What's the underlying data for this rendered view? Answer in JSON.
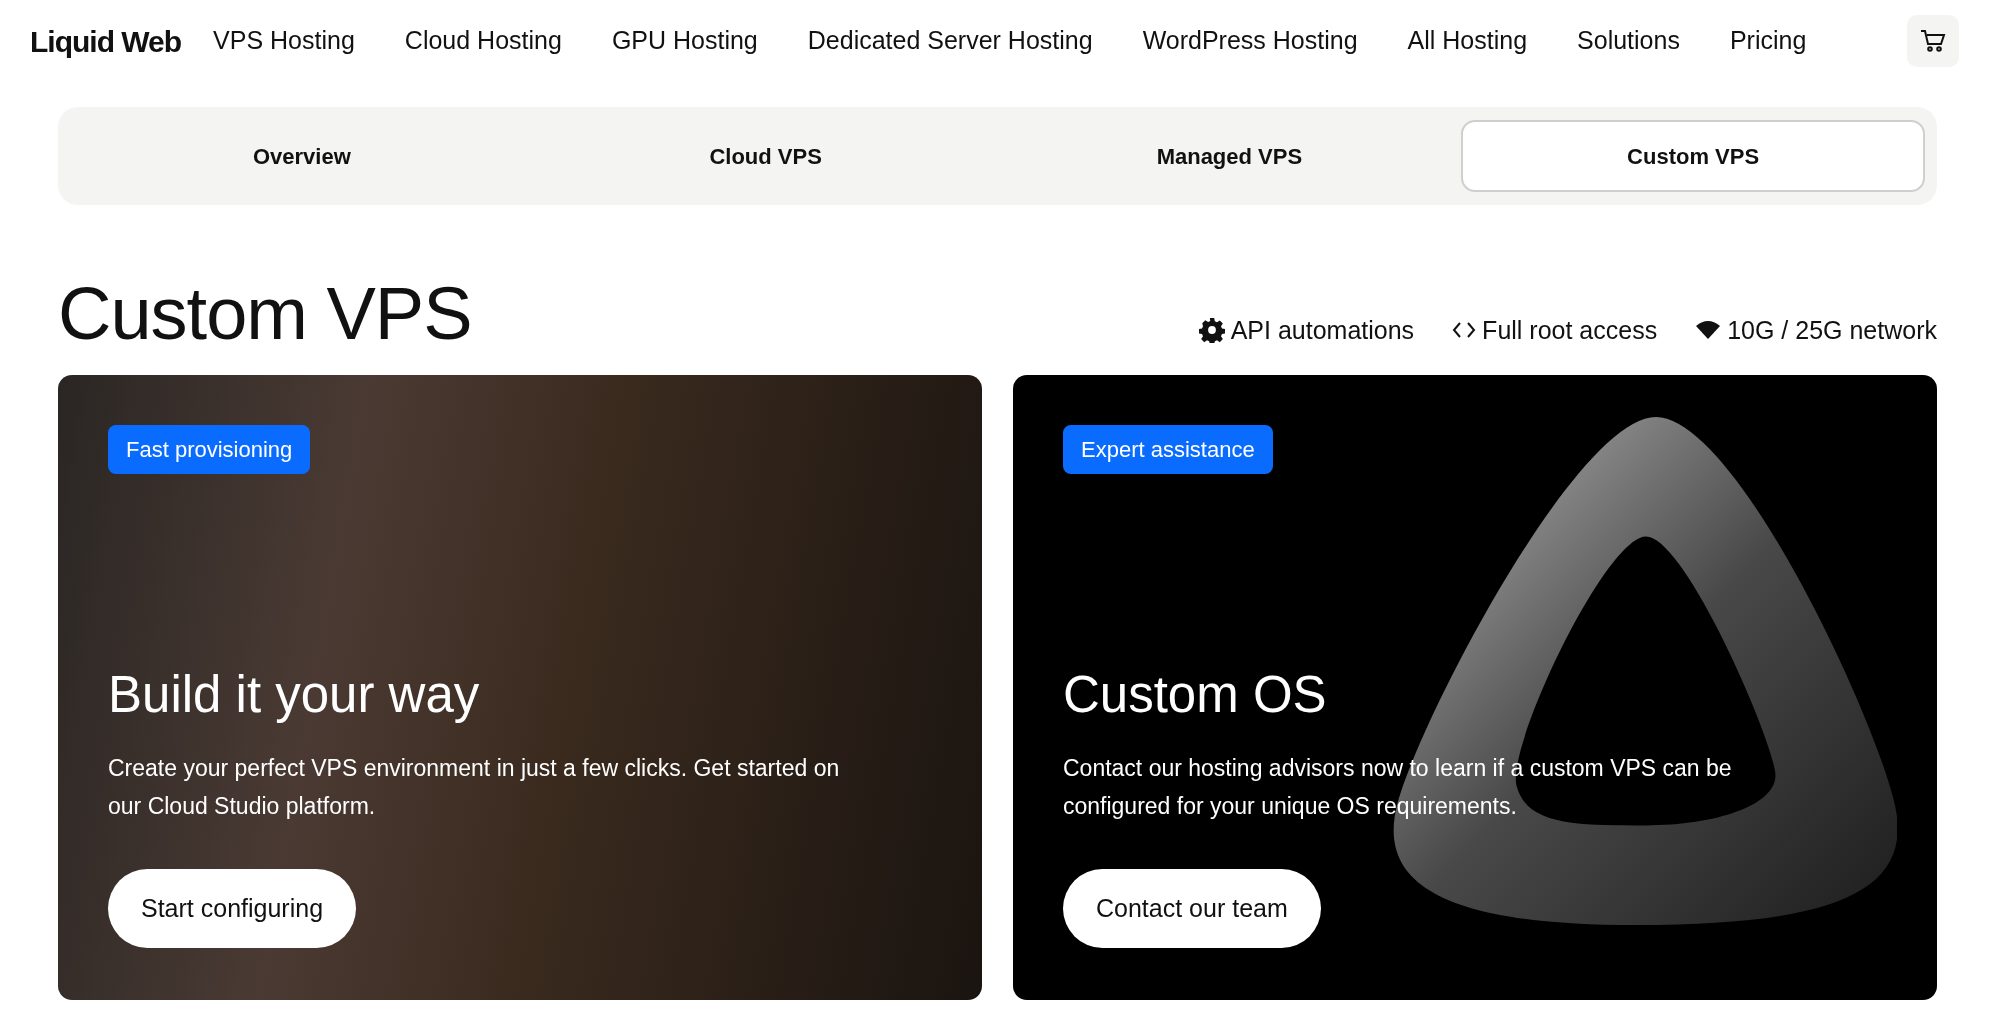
{
  "header": {
    "logo": "Liquid Web",
    "nav": [
      "VPS Hosting",
      "Cloud Hosting",
      "GPU Hosting",
      "Dedicated Server Hosting",
      "WordPress Hosting",
      "All Hosting",
      "Solutions",
      "Pricing"
    ]
  },
  "tabs": [
    {
      "label": "Overview",
      "selected": false
    },
    {
      "label": "Cloud VPS",
      "selected": false
    },
    {
      "label": "Managed VPS",
      "selected": false
    },
    {
      "label": "Custom VPS",
      "selected": true
    }
  ],
  "title": "Custom VPS",
  "features": [
    {
      "kind": "gear",
      "label": "API automations"
    },
    {
      "kind": "code",
      "label": "Full root access"
    },
    {
      "kind": "network",
      "label": "10G / 25G network"
    }
  ],
  "cards": [
    {
      "kind": "photo",
      "badge": "Fast provisioning",
      "heading": "Build it your way",
      "text": "Create your perfect VPS environment in just a few clicks. Get started on our Cloud Studio platform.",
      "button": "Start configuring"
    },
    {
      "kind": "shape",
      "badge": "Expert assistance",
      "heading": "Custom OS",
      "text": "Contact our hosting advisors now to learn if a custom VPS can be configured for your unique OS requirements.",
      "button": "Contact our team"
    }
  ]
}
